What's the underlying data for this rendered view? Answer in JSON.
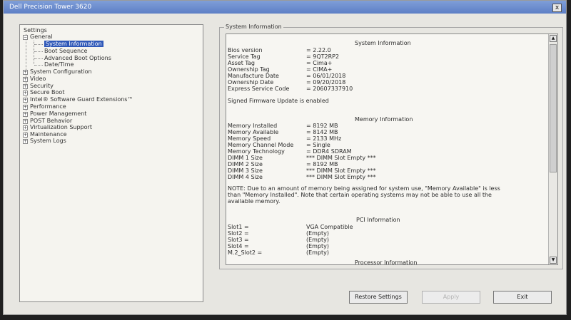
{
  "window": {
    "title": "Dell Precision Tower 3620",
    "close_label": "x"
  },
  "tree": {
    "root_label": "Settings",
    "items": [
      {
        "label": "General",
        "expander": "−",
        "level": 0
      },
      {
        "label": "System Information",
        "level": 1,
        "selected": true
      },
      {
        "label": "Boot Sequence",
        "level": 1
      },
      {
        "label": "Advanced Boot Options",
        "level": 1
      },
      {
        "label": "Date/Time",
        "level": 1
      },
      {
        "label": "System Configuration",
        "expander": "+",
        "level": 0
      },
      {
        "label": "Video",
        "expander": "+",
        "level": 0
      },
      {
        "label": "Security",
        "expander": "+",
        "level": 0
      },
      {
        "label": "Secure Boot",
        "expander": "+",
        "level": 0
      },
      {
        "label": "Intel® Software Guard Extensions™",
        "expander": "+",
        "level": 0
      },
      {
        "label": "Performance",
        "expander": "+",
        "level": 0
      },
      {
        "label": "Power Management",
        "expander": "+",
        "level": 0
      },
      {
        "label": "POST Behavior",
        "expander": "+",
        "level": 0
      },
      {
        "label": "Virtualization Support",
        "expander": "+",
        "level": 0
      },
      {
        "label": "Maintenance",
        "expander": "+",
        "level": 0
      },
      {
        "label": "System Logs",
        "expander": "+",
        "level": 0
      }
    ]
  },
  "info": {
    "group_title": "System Information",
    "system_heading": "System Information",
    "system_rows": [
      {
        "key": "Bios version",
        "value": "= 2.22.0"
      },
      {
        "key": "Service Tag",
        "value": "= 9QT2RP2"
      },
      {
        "key": "Asset Tag",
        "value": "= Cima+"
      },
      {
        "key": "Ownership Tag",
        "value": "= CIMA+"
      },
      {
        "key": "Manufacture Date",
        "value": "= 06/01/2018"
      },
      {
        "key": "Ownership Date",
        "value": "= 09/20/2018"
      },
      {
        "key": "Express Service Code",
        "value": "= 20607337910"
      }
    ],
    "firmware_note": "Signed Firmware Update is enabled",
    "memory_heading": "Memory Information",
    "memory_rows": [
      {
        "key": "Memory Installed",
        "value": "= 8192 MB"
      },
      {
        "key": "Memory Available",
        "value": "= 8142 MB"
      },
      {
        "key": "Memory Speed",
        "value": "= 2133 MHz"
      },
      {
        "key": "Memory Channel Mode",
        "value": "= Single"
      },
      {
        "key": "Memory Technology",
        "value": "= DDR4 SDRAM"
      },
      {
        "key": "DIMM 1 Size",
        "value": "*** DIMM Slot Empty ***"
      },
      {
        "key": "DIMM 2 Size",
        "value": "= 8192 MB"
      },
      {
        "key": "DIMM 3 Size",
        "value": "*** DIMM Slot Empty ***"
      },
      {
        "key": "DIMM 4 Size",
        "value": "*** DIMM Slot Empty ***"
      }
    ],
    "memory_note": "NOTE: Due to an amount of memory being assigned for system use, \"Memory Available\" is less than \"Memory Installed\". Note that certain operating systems may not be able to use all the available memory.",
    "pci_heading": "PCI Information",
    "pci_rows": [
      {
        "key": "Slot1 =",
        "value": "VGA Compatible"
      },
      {
        "key": "Slot2 =",
        "value": "(Empty)"
      },
      {
        "key": "Slot3 =",
        "value": "(Empty)"
      },
      {
        "key": "Slot4 =",
        "value": "(Empty)"
      },
      {
        "key": "M.2_Slot2 =",
        "value": "(Empty)"
      }
    ],
    "processor_heading": "Processor Information",
    "scroll_up": "▲",
    "scroll_down": "▼"
  },
  "buttons": {
    "restore": "Restore Settings",
    "apply": "Apply",
    "exit": "Exit"
  }
}
